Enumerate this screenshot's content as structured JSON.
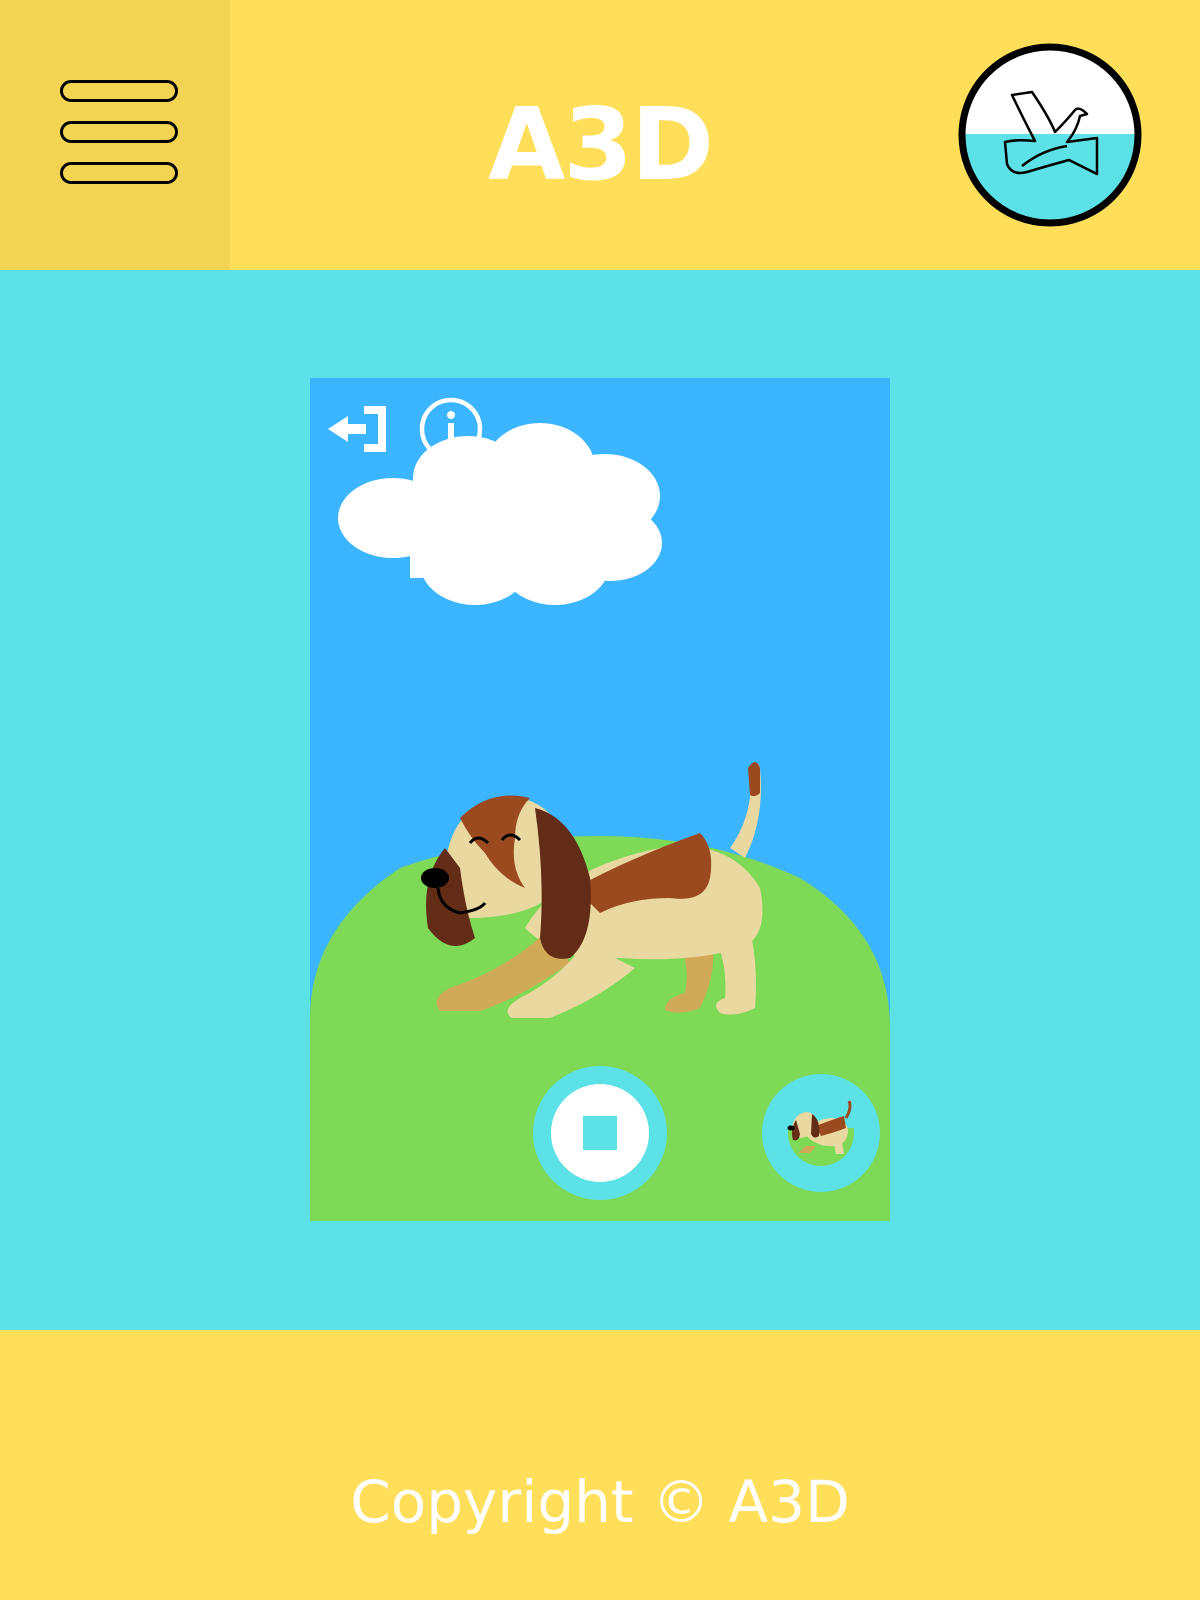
{
  "header": {
    "title": "A3D"
  },
  "icons": {
    "menu": "hamburger-menu-icon",
    "logo": "dove-logo-icon",
    "exit": "exit-icon",
    "info": "info-icon",
    "stop": "stop-icon",
    "dog_thumbnail": "dog-thumbnail-icon"
  },
  "colors": {
    "header_bg": "#ffde59",
    "menu_bg": "#f2d352",
    "page_bg": "#5ce1e6",
    "sky": "#3bb5ff",
    "grass": "#7ed957"
  },
  "footer": {
    "copyright": "Copyright © A3D"
  }
}
